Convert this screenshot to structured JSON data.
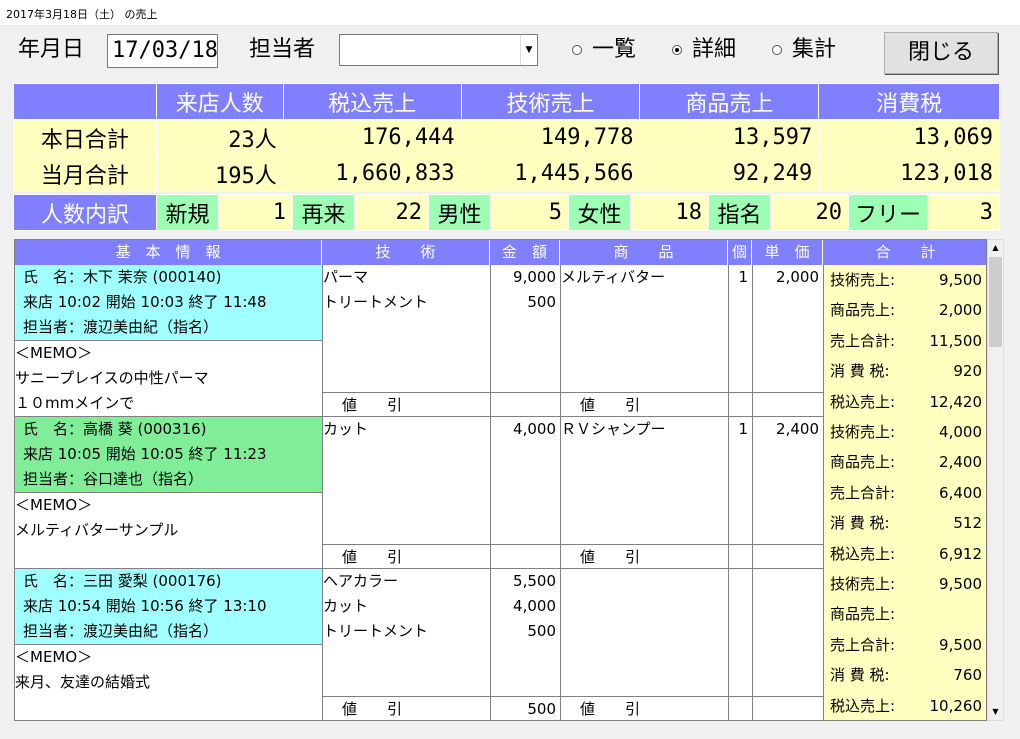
{
  "window_title": "2017年3月18日（土） の売上",
  "header": {
    "date_label": "年月日",
    "date_value": "17/03/18",
    "staff_label": "担当者",
    "staff_value": "",
    "radio": [
      {
        "label": "一覧",
        "selected": false
      },
      {
        "label": "詳細",
        "selected": true
      },
      {
        "label": "集計",
        "selected": false
      }
    ],
    "close_label": "閉じる"
  },
  "summary": {
    "columns": [
      "来店人数",
      "税込売上",
      "技術売上",
      "商品売上",
      "消費税"
    ],
    "rows": [
      {
        "label": "本日合計",
        "values": [
          "23人",
          "176,444",
          "149,778",
          "13,597",
          "13,069"
        ]
      },
      {
        "label": "当月合計",
        "values": [
          "195人",
          "1,660,833",
          "1,445,566",
          "92,249",
          "123,018"
        ]
      }
    ],
    "breakdown_label": "人数内訳",
    "breakdown": [
      {
        "label": "新規",
        "value": "1"
      },
      {
        "label": "再来",
        "value": "22"
      },
      {
        "label": "男性",
        "value": "5"
      },
      {
        "label": "女性",
        "value": "18"
      },
      {
        "label": "指名",
        "value": "20"
      },
      {
        "label": "フリー",
        "value": "3"
      }
    ]
  },
  "detail_headers": [
    "基　本　情　報",
    "技　　術",
    "金　額",
    "商　　品",
    "個",
    "単　価",
    "合　　計"
  ],
  "discount_label": "値　　引",
  "records": [
    {
      "name": "氏　名：木下 茉奈 (000140)",
      "visit": "来店 10:02 開始 10:03 終了 11:48",
      "staff": "担当者：渡辺美由紀（指名）",
      "color": "#a0ffff",
      "memo": [
        "＜MEMO＞",
        "サニープレイスの中性パーマ",
        "１０mmメインで"
      ],
      "tech": [
        {
          "name": "パーマ",
          "amount": "9,000"
        },
        {
          "name": "トリートメント",
          "amount": "500"
        }
      ],
      "goods": [
        {
          "name": "メルティバター",
          "qty": "1",
          "price": "2,000"
        }
      ],
      "tech_discount": "",
      "goods_discount": "",
      "totals": [
        {
          "k": "技術売上:",
          "v": "9,500"
        },
        {
          "k": "商品売上:",
          "v": "2,000"
        },
        {
          "k": "売上合計:",
          "v": "11,500"
        },
        {
          "k": "消 費 税:",
          "v": "920"
        },
        {
          "k": "税込売上:",
          "v": "12,420"
        }
      ]
    },
    {
      "name": "氏　名：高橋 葵 (000316)",
      "visit": "来店 10:05 開始 10:05 終了 11:23",
      "staff": "担当者：谷口達也（指名）",
      "color": "#80ee99",
      "memo": [
        "＜MEMO＞",
        "メルティバターサンプル",
        ""
      ],
      "tech": [
        {
          "name": "カット",
          "amount": "4,000"
        }
      ],
      "goods": [
        {
          "name": "ＲＶシャンプー",
          "qty": "1",
          "price": "2,400"
        }
      ],
      "tech_discount": "",
      "goods_discount": "",
      "totals": [
        {
          "k": "技術売上:",
          "v": "4,000"
        },
        {
          "k": "商品売上:",
          "v": "2,400"
        },
        {
          "k": "売上合計:",
          "v": "6,400"
        },
        {
          "k": "消 費 税:",
          "v": "512"
        },
        {
          "k": "税込売上:",
          "v": "6,912"
        }
      ]
    },
    {
      "name": "氏　名：三田 愛梨 (000176)",
      "visit": "来店 10:54 開始 10:56 終了 13:10",
      "staff": "担当者：渡辺美由紀（指名）",
      "color": "#a0ffff",
      "memo": [
        "＜MEMO＞",
        "来月、友達の結婚式",
        ""
      ],
      "tech": [
        {
          "name": "ヘアカラー",
          "amount": "5,500"
        },
        {
          "name": "カット",
          "amount": "4,000"
        },
        {
          "name": "トリートメント",
          "amount": "500"
        }
      ],
      "goods": [],
      "tech_discount": "500",
      "goods_discount": "",
      "totals": [
        {
          "k": "技術売上:",
          "v": "9,500"
        },
        {
          "k": "商品売上:",
          "v": ""
        },
        {
          "k": "売上合計:",
          "v": "9,500"
        },
        {
          "k": "消 費 税:",
          "v": "760"
        },
        {
          "k": "税込売上:",
          "v": "10,260"
        }
      ]
    }
  ]
}
